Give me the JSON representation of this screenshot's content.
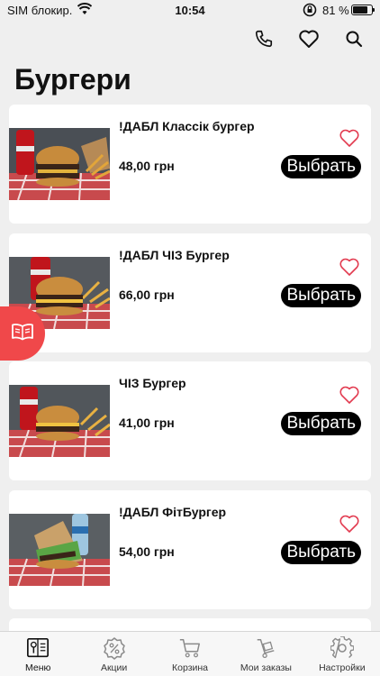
{
  "status_bar": {
    "carrier": "SIM блокир.",
    "time": "10:54",
    "battery_percent": "81 %",
    "battery_level": 0.81
  },
  "header": {
    "icons": [
      "phone-icon",
      "heart-icon",
      "search-icon"
    ]
  },
  "page_title": "Бургери",
  "products": [
    {
      "name": "!ДАБЛ Классік бургер",
      "price": "48,00 грн",
      "button": "Выбрать"
    },
    {
      "name": "!ДАБЛ ЧІЗ Бургер",
      "price": "66,00 грн",
      "button": "Выбрать"
    },
    {
      "name": "ЧІЗ Бургер",
      "price": "41,00 грн",
      "button": "Выбрать"
    },
    {
      "name": "!ДАБЛ ФітБургер",
      "price": "54,00 грн",
      "button": "Выбрать"
    }
  ],
  "tabbar": {
    "items": [
      {
        "label": "Меню",
        "icon": "menu-book-icon",
        "active": true
      },
      {
        "label": "Акции",
        "icon": "discount-badge-icon",
        "active": false
      },
      {
        "label": "Корзина",
        "icon": "cart-icon",
        "active": false
      },
      {
        "label": "Мои заказы",
        "icon": "hand-truck-icon",
        "active": false
      },
      {
        "label": "Настройки",
        "icon": "gear-icon",
        "active": false
      }
    ]
  },
  "colors": {
    "accent": "#f0484a",
    "favorite_outline": "#e23a4f",
    "button_bg": "#000000",
    "background": "#efefef"
  }
}
